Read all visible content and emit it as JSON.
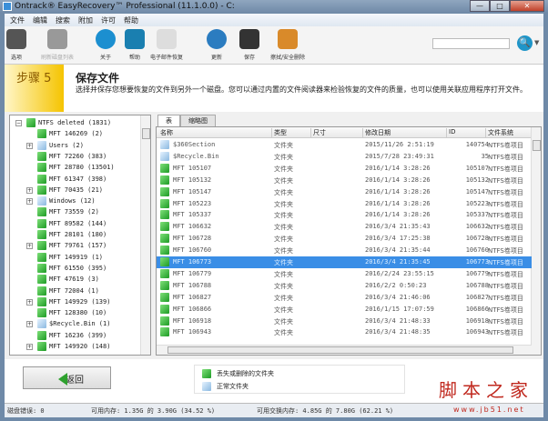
{
  "window": {
    "title": "Ontrack® EasyRecovery™ Professional (11.1.0.0) - C:",
    "min": "—",
    "max": "□",
    "close": "✕"
  },
  "menu": [
    "文件",
    "编辑",
    "搜索",
    "附加",
    "许可",
    "帮助"
  ],
  "toolbar": [
    {
      "label": "选项",
      "icon": "tools-icon",
      "color": "#555"
    },
    {
      "label": "刷新磁盘列表",
      "icon": "refresh-disk-icon",
      "color": "#999",
      "disabled": true
    },
    {
      "label": "关于",
      "icon": "info-icon",
      "color": "#1c8fd0"
    },
    {
      "label": "帮助",
      "icon": "help-book-icon",
      "color": "#1a7fb0"
    },
    {
      "label": "电子邮件恢复",
      "icon": "mail-icon",
      "color": "#ddd"
    },
    {
      "label": "更新",
      "icon": "update-icon",
      "color": "#2b7cc0"
    },
    {
      "label": "保存",
      "icon": "save-disk-icon",
      "color": "#333"
    },
    {
      "label": "擦拭/安全删除",
      "icon": "broom-icon",
      "color": "#d98a2a"
    }
  ],
  "search": {
    "placeholder": "",
    "button": "🔍",
    "dropdown": "▼"
  },
  "step": {
    "label": "步骤 5",
    "title": "保存文件",
    "description": "选择并保存您想要恢复的文件到另外一个磁盘。您可以通过内置的文件阅读器来检验恢复的文件的质量，也可以使用关联应用程序打开文件。"
  },
  "tree": [
    {
      "label": "NTFS deleted (1831)",
      "level": 0,
      "color": "g",
      "exp": "−"
    },
    {
      "label": "MFT 146269 (2)",
      "level": 1,
      "color": "g"
    },
    {
      "label": "Users (2)",
      "level": 1,
      "color": "b",
      "exp": "+"
    },
    {
      "label": "MFT 72260 (383)",
      "level": 1,
      "color": "g"
    },
    {
      "label": "MFT 28780 (13501)",
      "level": 1,
      "color": "g"
    },
    {
      "label": "MFT 61347 (398)",
      "level": 1,
      "color": "g"
    },
    {
      "label": "MFT 70435 (21)",
      "level": 1,
      "color": "g",
      "exp": "+"
    },
    {
      "label": "Windows (12)",
      "level": 1,
      "color": "b",
      "exp": "+"
    },
    {
      "label": "MFT 73559 (2)",
      "level": 1,
      "color": "g"
    },
    {
      "label": "MFT 89582 (144)",
      "level": 1,
      "color": "g"
    },
    {
      "label": "MFT 28101 (180)",
      "level": 1,
      "color": "g"
    },
    {
      "label": "MFT 79761 (157)",
      "level": 1,
      "color": "g",
      "exp": "+"
    },
    {
      "label": "MFT 149919 (1)",
      "level": 1,
      "color": "g"
    },
    {
      "label": "MFT 61550 (395)",
      "level": 1,
      "color": "g"
    },
    {
      "label": "MFT 47619 (3)",
      "level": 1,
      "color": "g"
    },
    {
      "label": "MFT 72004 (1)",
      "level": 1,
      "color": "g"
    },
    {
      "label": "MFT 149929 (139)",
      "level": 1,
      "color": "g",
      "exp": "+"
    },
    {
      "label": "MFT 128380 (10)",
      "level": 1,
      "color": "g"
    },
    {
      "label": "$Recycle.Bin (1)",
      "level": 1,
      "color": "b",
      "exp": "+"
    },
    {
      "label": "MFT 16236 (399)",
      "level": 1,
      "color": "g"
    },
    {
      "label": "MFT 149920 (148)",
      "level": 1,
      "color": "g",
      "exp": "+"
    }
  ],
  "tabs": [
    "表",
    "缩略图"
  ],
  "columns": [
    "名称",
    "类型",
    "尺寸",
    "修改日期",
    "ID",
    "文件系统"
  ],
  "rows": [
    [
      "$360Section",
      "文件夹",
      "",
      "2015/11/26 2:51:19",
      "140754",
      "NTFS卷项目",
      "b"
    ],
    [
      "$Recycle.Bin",
      "文件夹",
      "",
      "2015/7/28 23:49:31",
      "35",
      "NTFS卷项目",
      "b"
    ],
    [
      "MFT 105107",
      "文件夹",
      "",
      "2016/1/14 3:28:26",
      "105107",
      "NTFS卷项目",
      "g"
    ],
    [
      "MFT 105132",
      "文件夹",
      "",
      "2016/1/14 3:28:26",
      "105132",
      "NTFS卷项目",
      "g"
    ],
    [
      "MFT 105147",
      "文件夹",
      "",
      "2016/1/14 3:28:26",
      "105147",
      "NTFS卷项目",
      "g"
    ],
    [
      "MFT 105223",
      "文件夹",
      "",
      "2016/1/14 3:28:26",
      "105223",
      "NTFS卷项目",
      "g"
    ],
    [
      "MFT 105337",
      "文件夹",
      "",
      "2016/1/14 3:28:26",
      "105337",
      "NTFS卷项目",
      "g"
    ],
    [
      "MFT 106632",
      "文件夹",
      "",
      "2016/3/4 21:35:43",
      "106632",
      "NTFS卷项目",
      "g"
    ],
    [
      "MFT 106728",
      "文件夹",
      "",
      "2016/3/4 17:25:38",
      "106728",
      "NTFS卷项目",
      "g"
    ],
    [
      "MFT 106760",
      "文件夹",
      "",
      "2016/3/4 21:35:44",
      "106760",
      "NTFS卷项目",
      "g"
    ],
    [
      "MFT 106773",
      "文件夹",
      "",
      "2016/3/4 21:35:45",
      "106773",
      "NTFS卷项目",
      "g"
    ],
    [
      "MFT 106779",
      "文件夹",
      "",
      "2016/2/24 23:55:15",
      "106779",
      "NTFS卷项目",
      "g"
    ],
    [
      "MFT 106788",
      "文件夹",
      "",
      "2016/2/2 0:50:23",
      "106788",
      "NTFS卷项目",
      "g"
    ],
    [
      "MFT 106827",
      "文件夹",
      "",
      "2016/3/4 21:46:06",
      "106827",
      "NTFS卷项目",
      "g"
    ],
    [
      "MFT 106866",
      "文件夹",
      "",
      "2016/1/15 17:07:59",
      "106866",
      "NTFS卷项目",
      "g"
    ],
    [
      "MFT 106918",
      "文件夹",
      "",
      "2016/3/4 21:48:33",
      "106918",
      "NTFS卷项目",
      "g"
    ],
    [
      "MFT 106943",
      "文件夹",
      "",
      "2016/3/4 21:48:35",
      "106943",
      "NTFS卷项目",
      "g"
    ]
  ],
  "selected_row": 10,
  "back_label": "返回",
  "legend": [
    "丢失或删除的文件夹",
    "正常文件夹"
  ],
  "status": {
    "disk_errors": "磁盘错误: 0",
    "memory": "可用内存: 1.35G 的 3.90G (34.52 %)",
    "swap": "可用交换内存: 4.85G 的 7.80G (62.21 %)"
  },
  "watermark": {
    "text": "脚本之家",
    "url": "www.jb51.net"
  }
}
